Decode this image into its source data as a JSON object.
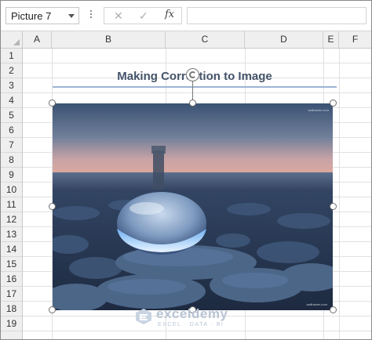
{
  "formula_bar": {
    "name_box_value": "Picture 7",
    "cancel_symbol": "✕",
    "enter_symbol": "✓",
    "fx_symbol": "fx",
    "formula_value": ""
  },
  "column_headers": [
    "A",
    "B",
    "C",
    "D",
    "E",
    "F"
  ],
  "row_headers": [
    "1",
    "2",
    "3",
    "4",
    "5",
    "6",
    "7",
    "8",
    "9",
    "10",
    "11",
    "12",
    "13",
    "14",
    "15",
    "16",
    "17",
    "18",
    "19"
  ],
  "sheet": {
    "title": "Making Correction to Image"
  },
  "picture": {
    "name": "Picture 7",
    "description_icon": "photo-crystal-ball-on-pebbles",
    "corner_mark_top": "wallhaven.com",
    "corner_mark_bottom": "wallhaven.com"
  },
  "watermark": {
    "name": "exceldemy",
    "tagline": "EXCEL · DATA · BI"
  },
  "colors": {
    "title_text": "#44546a",
    "title_underline": "#9db4d4",
    "header_bg": "#efefef",
    "gridline": "#e1e1e1"
  }
}
